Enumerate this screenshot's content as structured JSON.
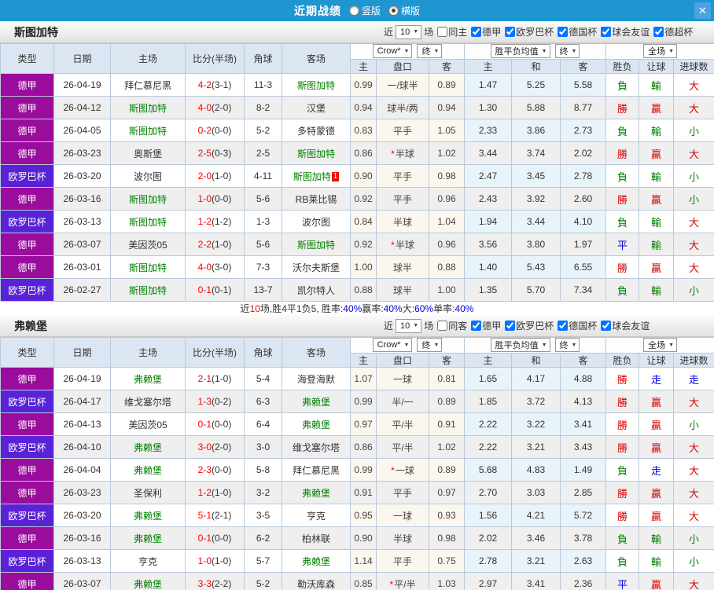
{
  "titlebar": {
    "title": "近期战绩",
    "layout_options": [
      {
        "label": "竖版",
        "selected": false
      },
      {
        "label": "横版",
        "selected": true
      }
    ],
    "close_label": "✕"
  },
  "filters_common": {
    "near_label": "近",
    "count": "10",
    "games_label": "场"
  },
  "table_header": {
    "main_cols": [
      "类型",
      "日期",
      "主场",
      "比分(半场)",
      "角球",
      "客场"
    ],
    "odds_source_select": "Crow*",
    "odds_final_select": "终",
    "avg_select": "胜平负均值",
    "avg_final_select": "终",
    "fulltime_select": "全场",
    "sub_cols": [
      "主",
      "盘口",
      "客",
      "主",
      "和",
      "客",
      "胜负",
      "让球",
      "进球数"
    ]
  },
  "colors": {
    "titlebar_blue": "#1e96d2",
    "league_dejia_purple": "#990c9c",
    "league_europa_violet": "#5a22d6",
    "subject_team_green": "#008000",
    "score_red": "#ff0000",
    "win_red": "#d80000",
    "lose_green": "#008000",
    "draw_blue": "#0000e0"
  },
  "sections": [
    {
      "team": "斯图加特",
      "same_filter": "同主",
      "same_checked": false,
      "league_filters": [
        "德甲",
        "欧罗巴杯",
        "德国杯",
        "球会友谊",
        "德超杯"
      ],
      "rows": [
        {
          "league": "德甲",
          "league_type": "dejia",
          "date": "26-04-19",
          "home": "拜仁慕尼黑",
          "home_is_subject": false,
          "score_full": "4-2",
          "score_half": "(3-1)",
          "corners": "11-3",
          "away": "斯图加特",
          "away_is_subject": true,
          "away_red_cards": "",
          "odds_home": "0.99",
          "handicap": "一/球半",
          "handicap_star": false,
          "odds_away": "0.89",
          "avg_home": "1.47",
          "avg_draw": "5.25",
          "avg_away": "5.58",
          "result": {
            "text": "負",
            "color": "green"
          },
          "handicap_result": {
            "text": "輸",
            "color": "green"
          },
          "goals_result": {
            "text": "大",
            "color": "red"
          }
        },
        {
          "league": "德甲",
          "league_type": "dejia",
          "date": "26-04-12",
          "home": "斯图加特",
          "home_is_subject": true,
          "score_full": "4-0",
          "score_half": "(2-0)",
          "corners": "8-2",
          "away": "汉堡",
          "away_is_subject": false,
          "away_red_cards": "",
          "odds_home": "0.94",
          "handicap": "球半/两",
          "handicap_star": false,
          "odds_away": "0.94",
          "avg_home": "1.30",
          "avg_draw": "5.88",
          "avg_away": "8.77",
          "result": {
            "text": "勝",
            "color": "red"
          },
          "handicap_result": {
            "text": "贏",
            "color": "red"
          },
          "goals_result": {
            "text": "大",
            "color": "red"
          }
        },
        {
          "league": "德甲",
          "league_type": "dejia",
          "date": "26-04-05",
          "home": "斯图加特",
          "home_is_subject": true,
          "score_full": "0-2",
          "score_half": "(0-0)",
          "corners": "5-2",
          "away": "多特蒙德",
          "away_is_subject": false,
          "away_red_cards": "",
          "odds_home": "0.83",
          "handicap": "平手",
          "handicap_star": false,
          "odds_away": "1.05",
          "avg_home": "2.33",
          "avg_draw": "3.86",
          "avg_away": "2.73",
          "result": {
            "text": "負",
            "color": "green"
          },
          "handicap_result": {
            "text": "輸",
            "color": "green"
          },
          "goals_result": {
            "text": "小",
            "color": "green"
          }
        },
        {
          "league": "德甲",
          "league_type": "dejia",
          "date": "26-03-23",
          "home": "奥斯堡",
          "home_is_subject": false,
          "score_full": "2-5",
          "score_half": "(0-3)",
          "corners": "2-5",
          "away": "斯图加特",
          "away_is_subject": true,
          "away_red_cards": "",
          "odds_home": "0.86",
          "handicap": "半球",
          "handicap_star": true,
          "odds_away": "1.02",
          "avg_home": "3.44",
          "avg_draw": "3.74",
          "avg_away": "2.02",
          "result": {
            "text": "勝",
            "color": "red"
          },
          "handicap_result": {
            "text": "贏",
            "color": "red"
          },
          "goals_result": {
            "text": "大",
            "color": "red"
          }
        },
        {
          "league": "欧罗巴杯",
          "league_type": "europa",
          "date": "26-03-20",
          "home": "波尔图",
          "home_is_subject": false,
          "score_full": "2-0",
          "score_half": "(1-0)",
          "corners": "4-11",
          "away": "斯图加特",
          "away_is_subject": true,
          "away_red_cards": "1",
          "odds_home": "0.90",
          "handicap": "平手",
          "handicap_star": false,
          "odds_away": "0.98",
          "avg_home": "2.47",
          "avg_draw": "3.45",
          "avg_away": "2.78",
          "result": {
            "text": "負",
            "color": "green"
          },
          "handicap_result": {
            "text": "輸",
            "color": "green"
          },
          "goals_result": {
            "text": "小",
            "color": "green"
          }
        },
        {
          "league": "德甲",
          "league_type": "dejia",
          "date": "26-03-16",
          "home": "斯图加特",
          "home_is_subject": true,
          "score_full": "1-0",
          "score_half": "(0-0)",
          "corners": "5-6",
          "away": "RB莱比锡",
          "away_is_subject": false,
          "away_red_cards": "",
          "odds_home": "0.92",
          "handicap": "平手",
          "handicap_star": false,
          "odds_away": "0.96",
          "avg_home": "2.43",
          "avg_draw": "3.92",
          "avg_away": "2.60",
          "result": {
            "text": "勝",
            "color": "red"
          },
          "handicap_result": {
            "text": "贏",
            "color": "red"
          },
          "goals_result": {
            "text": "小",
            "color": "green"
          }
        },
        {
          "league": "欧罗巴杯",
          "league_type": "europa",
          "date": "26-03-13",
          "home": "斯图加特",
          "home_is_subject": true,
          "score_full": "1-2",
          "score_half": "(1-2)",
          "corners": "1-3",
          "away": "波尔图",
          "away_is_subject": false,
          "away_red_cards": "",
          "odds_home": "0.84",
          "handicap": "半球",
          "handicap_star": false,
          "odds_away": "1.04",
          "avg_home": "1.94",
          "avg_draw": "3.44",
          "avg_away": "4.10",
          "result": {
            "text": "負",
            "color": "green"
          },
          "handicap_result": {
            "text": "輸",
            "color": "green"
          },
          "goals_result": {
            "text": "大",
            "color": "red"
          }
        },
        {
          "league": "德甲",
          "league_type": "dejia",
          "date": "26-03-07",
          "home": "美因茨05",
          "home_is_subject": false,
          "score_full": "2-2",
          "score_half": "(1-0)",
          "corners": "5-6",
          "away": "斯图加特",
          "away_is_subject": true,
          "away_red_cards": "",
          "odds_home": "0.92",
          "handicap": "半球",
          "handicap_star": true,
          "odds_away": "0.96",
          "avg_home": "3.56",
          "avg_draw": "3.80",
          "avg_away": "1.97",
          "result": {
            "text": "平",
            "color": "blue"
          },
          "handicap_result": {
            "text": "輸",
            "color": "green"
          },
          "goals_result": {
            "text": "大",
            "color": "red"
          }
        },
        {
          "league": "德甲",
          "league_type": "dejia",
          "date": "26-03-01",
          "home": "斯图加特",
          "home_is_subject": true,
          "score_full": "4-0",
          "score_half": "(3-0)",
          "corners": "7-3",
          "away": "沃尔夫斯堡",
          "away_is_subject": false,
          "away_red_cards": "",
          "odds_home": "1.00",
          "handicap": "球半",
          "handicap_star": false,
          "odds_away": "0.88",
          "avg_home": "1.40",
          "avg_draw": "5.43",
          "avg_away": "6.55",
          "result": {
            "text": "勝",
            "color": "red"
          },
          "handicap_result": {
            "text": "贏",
            "color": "red"
          },
          "goals_result": {
            "text": "大",
            "color": "red"
          }
        },
        {
          "league": "欧罗巴杯",
          "league_type": "europa",
          "date": "26-02-27",
          "home": "斯图加特",
          "home_is_subject": true,
          "score_full": "0-1",
          "score_half": "(0-1)",
          "corners": "13-7",
          "away": "凯尔特人",
          "away_is_subject": false,
          "away_red_cards": "",
          "odds_home": "0.88",
          "handicap": "球半",
          "handicap_star": false,
          "odds_away": "1.00",
          "avg_home": "1.35",
          "avg_draw": "5.70",
          "avg_away": "7.34",
          "result": {
            "text": "負",
            "color": "green"
          },
          "handicap_result": {
            "text": "輸",
            "color": "green"
          },
          "goals_result": {
            "text": "小",
            "color": "green"
          }
        }
      ],
      "summary": [
        [
          "近",
          "dark"
        ],
        [
          "10",
          "red"
        ],
        [
          "场,胜4平1负5, 胜率:",
          "dark"
        ],
        [
          "40%",
          "blue"
        ],
        [
          " 赢率:",
          "dark"
        ],
        [
          "40%",
          "blue"
        ],
        [
          " 大:",
          "dark"
        ],
        [
          "60%",
          "blue"
        ],
        [
          " 单率:",
          "dark"
        ],
        [
          "40%",
          "blue"
        ]
      ]
    },
    {
      "team": "弗赖堡",
      "same_filter": "同客",
      "same_checked": false,
      "league_filters": [
        "德甲",
        "欧罗巴杯",
        "德国杯",
        "球会友谊"
      ],
      "rows": [
        {
          "league": "德甲",
          "league_type": "dejia",
          "date": "26-04-19",
          "home": "弗赖堡",
          "home_is_subject": true,
          "score_full": "2-1",
          "score_half": "(1-0)",
          "corners": "5-4",
          "away": "海登海默",
          "away_is_subject": false,
          "away_red_cards": "",
          "odds_home": "1.07",
          "handicap": "一球",
          "handicap_star": false,
          "odds_away": "0.81",
          "avg_home": "1.65",
          "avg_draw": "4.17",
          "avg_away": "4.88",
          "result": {
            "text": "勝",
            "color": "red"
          },
          "handicap_result": {
            "text": "走",
            "color": "blue"
          },
          "goals_result": {
            "text": "走",
            "color": "blue"
          }
        },
        {
          "league": "欧罗巴杯",
          "league_type": "europa",
          "date": "26-04-17",
          "home": "维戈塞尔塔",
          "home_is_subject": false,
          "score_full": "1-3",
          "score_half": "(0-2)",
          "corners": "6-3",
          "away": "弗赖堡",
          "away_is_subject": true,
          "away_red_cards": "",
          "odds_home": "0.99",
          "handicap": "半/一",
          "handicap_star": false,
          "odds_away": "0.89",
          "avg_home": "1.85",
          "avg_draw": "3.72",
          "avg_away": "4.13",
          "result": {
            "text": "勝",
            "color": "red"
          },
          "handicap_result": {
            "text": "贏",
            "color": "red"
          },
          "goals_result": {
            "text": "大",
            "color": "red"
          }
        },
        {
          "league": "德甲",
          "league_type": "dejia",
          "date": "26-04-13",
          "home": "美因茨05",
          "home_is_subject": false,
          "score_full": "0-1",
          "score_half": "(0-0)",
          "corners": "6-4",
          "away": "弗赖堡",
          "away_is_subject": true,
          "away_red_cards": "",
          "odds_home": "0.97",
          "handicap": "平/半",
          "handicap_star": false,
          "odds_away": "0.91",
          "avg_home": "2.22",
          "avg_draw": "3.22",
          "avg_away": "3.41",
          "result": {
            "text": "勝",
            "color": "red"
          },
          "handicap_result": {
            "text": "贏",
            "color": "red"
          },
          "goals_result": {
            "text": "小",
            "color": "green"
          }
        },
        {
          "league": "欧罗巴杯",
          "league_type": "europa",
          "date": "26-04-10",
          "home": "弗赖堡",
          "home_is_subject": true,
          "score_full": "3-0",
          "score_half": "(2-0)",
          "corners": "3-0",
          "away": "维戈塞尔塔",
          "away_is_subject": false,
          "away_red_cards": "",
          "odds_home": "0.86",
          "handicap": "平/半",
          "handicap_star": false,
          "odds_away": "1.02",
          "avg_home": "2.22",
          "avg_draw": "3.21",
          "avg_away": "3.43",
          "result": {
            "text": "勝",
            "color": "red"
          },
          "handicap_result": {
            "text": "贏",
            "color": "red"
          },
          "goals_result": {
            "text": "大",
            "color": "red"
          }
        },
        {
          "league": "德甲",
          "league_type": "dejia",
          "date": "26-04-04",
          "home": "弗赖堡",
          "home_is_subject": true,
          "score_full": "2-3",
          "score_half": "(0-0)",
          "corners": "5-8",
          "away": "拜仁慕尼黑",
          "away_is_subject": false,
          "away_red_cards": "",
          "odds_home": "0.99",
          "handicap": "一球",
          "handicap_star": true,
          "odds_away": "0.89",
          "avg_home": "5.68",
          "avg_draw": "4.83",
          "avg_away": "1.49",
          "result": {
            "text": "負",
            "color": "green"
          },
          "handicap_result": {
            "text": "走",
            "color": "blue"
          },
          "goals_result": {
            "text": "大",
            "color": "red"
          }
        },
        {
          "league": "德甲",
          "league_type": "dejia",
          "date": "26-03-23",
          "home": "圣保利",
          "home_is_subject": false,
          "score_full": "1-2",
          "score_half": "(1-0)",
          "corners": "3-2",
          "away": "弗赖堡",
          "away_is_subject": true,
          "away_red_cards": "",
          "odds_home": "0.91",
          "handicap": "平手",
          "handicap_star": false,
          "odds_away": "0.97",
          "avg_home": "2.70",
          "avg_draw": "3.03",
          "avg_away": "2.85",
          "result": {
            "text": "勝",
            "color": "red"
          },
          "handicap_result": {
            "text": "贏",
            "color": "red"
          },
          "goals_result": {
            "text": "大",
            "color": "red"
          }
        },
        {
          "league": "欧罗巴杯",
          "league_type": "europa",
          "date": "26-03-20",
          "home": "弗赖堡",
          "home_is_subject": true,
          "score_full": "5-1",
          "score_half": "(2-1)",
          "corners": "3-5",
          "away": "亨克",
          "away_is_subject": false,
          "away_red_cards": "",
          "odds_home": "0.95",
          "handicap": "一球",
          "handicap_star": false,
          "odds_away": "0.93",
          "avg_home": "1.56",
          "avg_draw": "4.21",
          "avg_away": "5.72",
          "result": {
            "text": "勝",
            "color": "red"
          },
          "handicap_result": {
            "text": "贏",
            "color": "red"
          },
          "goals_result": {
            "text": "大",
            "color": "red"
          }
        },
        {
          "league": "德甲",
          "league_type": "dejia",
          "date": "26-03-16",
          "home": "弗赖堡",
          "home_is_subject": true,
          "score_full": "0-1",
          "score_half": "(0-0)",
          "corners": "6-2",
          "away": "柏林联",
          "away_is_subject": false,
          "away_red_cards": "",
          "odds_home": "0.90",
          "handicap": "半球",
          "handicap_star": false,
          "odds_away": "0.98",
          "avg_home": "2.02",
          "avg_draw": "3.46",
          "avg_away": "3.78",
          "result": {
            "text": "負",
            "color": "green"
          },
          "handicap_result": {
            "text": "輸",
            "color": "green"
          },
          "goals_result": {
            "text": "小",
            "color": "green"
          }
        },
        {
          "league": "欧罗巴杯",
          "league_type": "europa",
          "date": "26-03-13",
          "home": "亨克",
          "home_is_subject": false,
          "score_full": "1-0",
          "score_half": "(1-0)",
          "corners": "5-7",
          "away": "弗赖堡",
          "away_is_subject": true,
          "away_red_cards": "",
          "odds_home": "1.14",
          "handicap": "平手",
          "handicap_star": false,
          "odds_away": "0.75",
          "avg_home": "2.78",
          "avg_draw": "3.21",
          "avg_away": "2.63",
          "result": {
            "text": "負",
            "color": "green"
          },
          "handicap_result": {
            "text": "輸",
            "color": "green"
          },
          "goals_result": {
            "text": "小",
            "color": "green"
          }
        },
        {
          "league": "德甲",
          "league_type": "dejia",
          "date": "26-03-07",
          "home": "弗赖堡",
          "home_is_subject": true,
          "score_full": "3-3",
          "score_half": "(2-2)",
          "corners": "5-2",
          "away": "勒沃库森",
          "away_is_subject": false,
          "away_red_cards": "",
          "odds_home": "0.85",
          "handicap": "平/半",
          "handicap_star": true,
          "odds_away": "1.03",
          "avg_home": "2.97",
          "avg_draw": "3.41",
          "avg_away": "2.36",
          "result": {
            "text": "平",
            "color": "blue"
          },
          "handicap_result": {
            "text": "贏",
            "color": "red"
          },
          "goals_result": {
            "text": "大",
            "color": "red"
          }
        }
      ],
      "summary": null
    }
  ]
}
